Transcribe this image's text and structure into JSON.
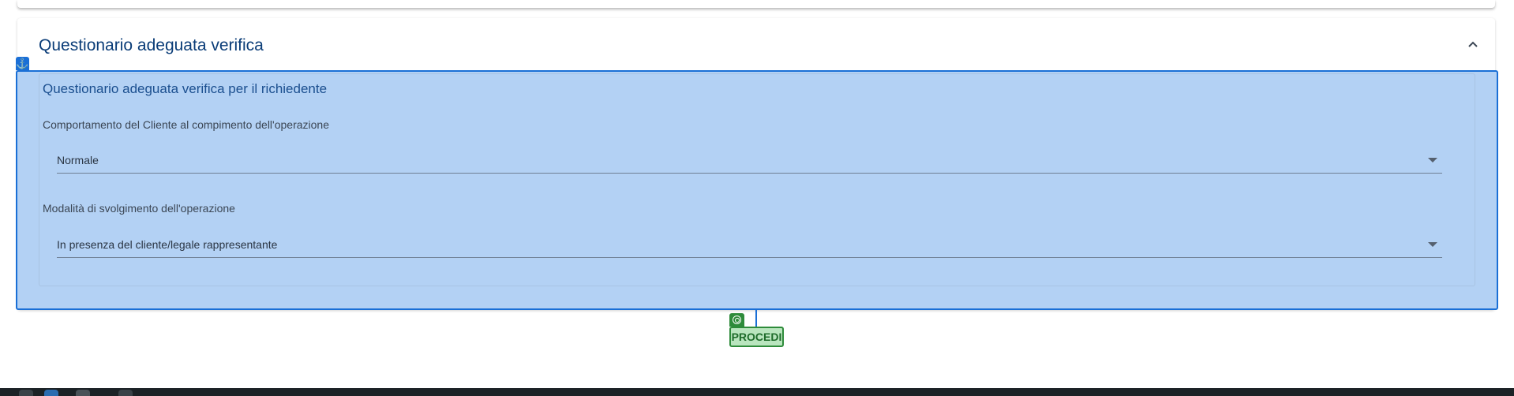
{
  "panel": {
    "title": "Questionario adeguata verifica",
    "collapse_icon": "chevron-up-icon"
  },
  "overlay": {
    "anchor_icon": "anchor-icon",
    "accent_color": "#1a6fd6"
  },
  "section": {
    "title": "Questionario adeguata verifica per il richiedente"
  },
  "fields": [
    {
      "label": "Comportamento del Cliente al compimento dell'operazione",
      "value": "Normale"
    },
    {
      "label": "Modalità di svolgimento dell'operazione",
      "value": "In presenza del cliente/legale rappresentante"
    }
  ],
  "action": {
    "label": "PROCEDI",
    "icon": "target-icon",
    "color": "#2e8b3a"
  }
}
